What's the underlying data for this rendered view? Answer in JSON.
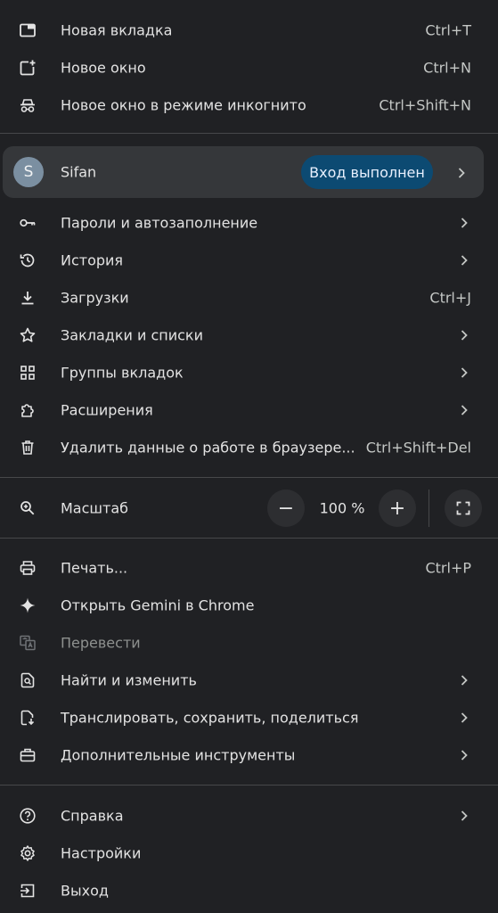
{
  "section1": [
    {
      "id": "new-tab",
      "label": "Новая вкладка",
      "shortcut": "Ctrl+T",
      "icon": "new-tab-icon"
    },
    {
      "id": "new-window",
      "label": "Новое окно",
      "shortcut": "Ctrl+N",
      "icon": "new-window-icon"
    },
    {
      "id": "incognito",
      "label": "Новое окно в режиме инкогнито",
      "shortcut": "Ctrl+Shift+N",
      "icon": "incognito-icon"
    }
  ],
  "profile": {
    "avatar_letter": "S",
    "name": "Sifan",
    "status": "Вход выполнен"
  },
  "section2": [
    {
      "id": "passwords",
      "label": "Пароли и автозаполнение",
      "icon": "key-icon"
    },
    {
      "id": "history",
      "label": "История",
      "icon": "history-icon"
    },
    {
      "id": "downloads",
      "label": "Загрузки",
      "shortcut": "Ctrl+J",
      "icon": "download-icon"
    },
    {
      "id": "bookmarks",
      "label": "Закладки и списки",
      "icon": "star-icon"
    },
    {
      "id": "tab-groups",
      "label": "Группы вкладок",
      "icon": "grid-icon"
    },
    {
      "id": "extensions",
      "label": "Расширения",
      "icon": "puzzle-icon"
    },
    {
      "id": "clear-data",
      "label": "Удалить данные о работе в браузере...",
      "shortcut": "Ctrl+Shift+Del",
      "icon": "trash-icon"
    }
  ],
  "zoom": {
    "label": "Масштаб",
    "minus": "−",
    "value": "100 %",
    "plus": "+",
    "icon": "zoom-icon"
  },
  "section3": [
    {
      "id": "print",
      "label": "Печать...",
      "shortcut": "Ctrl+P",
      "icon": "print-icon"
    },
    {
      "id": "gemini",
      "label": "Открыть Gemini в Chrome",
      "icon": "sparkle-icon"
    },
    {
      "id": "translate",
      "label": "Перевести",
      "icon": "translate-icon",
      "disabled": true
    },
    {
      "id": "find",
      "label": "Найти и изменить",
      "icon": "find-icon"
    },
    {
      "id": "cast",
      "label": "Транслировать, сохранить, поделиться",
      "icon": "cast-save-icon"
    },
    {
      "id": "more-tools",
      "label": "Дополнительные инструменты",
      "icon": "toolbox-icon"
    }
  ],
  "section4": [
    {
      "id": "help",
      "label": "Справка",
      "icon": "help-icon"
    },
    {
      "id": "settings",
      "label": "Настройки",
      "icon": "gear-icon"
    },
    {
      "id": "exit",
      "label": "Выход",
      "icon": "exit-icon"
    }
  ],
  "colors": {
    "background": "#202124",
    "profile_bg": "#35373a",
    "badge_bg": "#0c4a72",
    "text": "#e3e3e3",
    "separator": "#47484a"
  }
}
